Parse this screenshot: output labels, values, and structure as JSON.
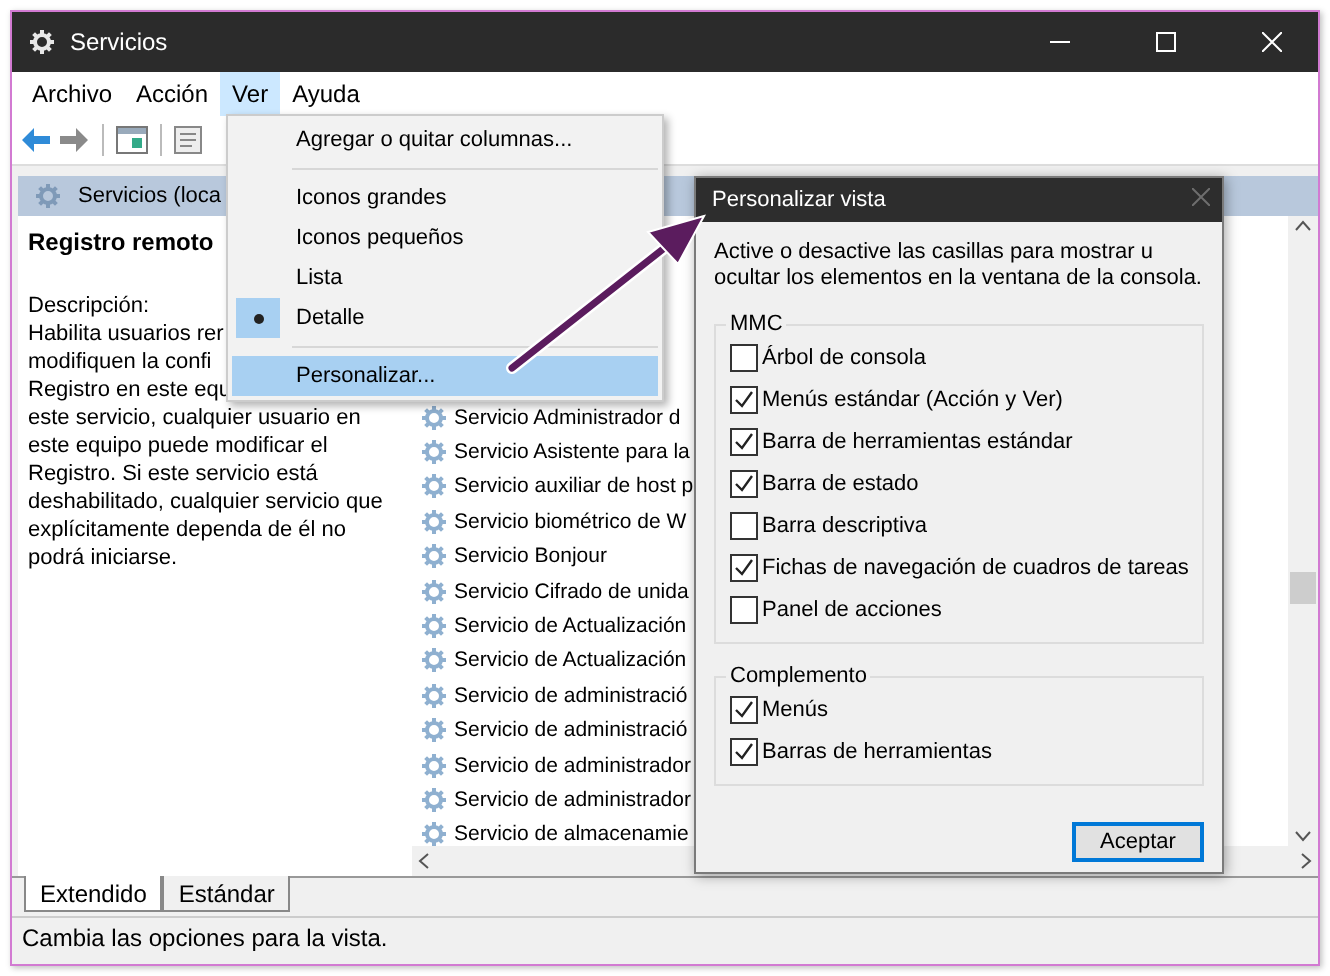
{
  "window": {
    "title": "Servicios"
  },
  "menu_bar": [
    {
      "label": "Archivo",
      "selected": false
    },
    {
      "label": "Acción",
      "selected": false
    },
    {
      "label": "Ver",
      "selected": true
    },
    {
      "label": "Ayuda",
      "selected": false
    }
  ],
  "scope_header": "Servicios (loca",
  "details": {
    "title": "Registro remoto",
    "lines": [
      "Descripción:",
      "Habilita usuarios rer",
      "modifiquen la confi",
      "Registro en este equ",
      "este servicio, cualquier usuario en",
      "este equipo puede modificar el",
      "Registro. Si este servicio está",
      "deshabilitado, cualquier servicio que",
      "explícitamente dependa de él no",
      "podrá iniciarse."
    ]
  },
  "services": [
    "Servicio Administrador d",
    "Servicio Asistente para la",
    "Servicio auxiliar de host p",
    "Servicio biométrico de W",
    "Servicio Bonjour",
    "Servicio Cifrado de unida",
    "Servicio de Actualización",
    "Servicio de Actualización",
    "Servicio de administració",
    "Servicio de administració",
    "Servicio de administrador",
    "Servicio de administrador",
    "Servicio de almacenamie"
  ],
  "bottom_tabs": [
    {
      "label": "Extendido",
      "selected": true
    },
    {
      "label": "Estándar",
      "selected": false
    }
  ],
  "status_bar": "Cambia las opciones para la vista.",
  "view_menu": {
    "items": [
      {
        "kind": "item",
        "label": "Agregar o quitar columnas...",
        "checked": false,
        "selected": false
      },
      {
        "kind": "separator"
      },
      {
        "kind": "item",
        "label": "Iconos grandes",
        "checked": false,
        "selected": false
      },
      {
        "kind": "item",
        "label": "Iconos pequeños",
        "checked": false,
        "selected": false
      },
      {
        "kind": "item",
        "label": "Lista",
        "checked": false,
        "selected": false
      },
      {
        "kind": "item",
        "label": "Detalle",
        "checked": true,
        "selected": false
      },
      {
        "kind": "separator"
      },
      {
        "kind": "item",
        "label": "Personalizar...",
        "checked": false,
        "selected": true
      }
    ]
  },
  "dialog": {
    "title": "Personalizar vista",
    "intro": "Active o desactive las casillas para mostrar u ocultar los elementos en la ventana de la consola.",
    "groups": [
      {
        "label": "MMC",
        "options": [
          {
            "label": "Árbol de consola",
            "checked": false
          },
          {
            "label": "Menús estándar (Acción y Ver)",
            "checked": true
          },
          {
            "label": "Barra de herramientas estándar",
            "checked": true
          },
          {
            "label": "Barra de estado",
            "checked": true
          },
          {
            "label": "Barra descriptiva",
            "checked": false
          },
          {
            "label": "Fichas de navegación de cuadros de tareas",
            "checked": true
          },
          {
            "label": "Panel de acciones",
            "checked": false
          }
        ]
      },
      {
        "label": "Complemento",
        "options": [
          {
            "label": "Menús",
            "checked": true
          },
          {
            "label": "Barras de herramientas",
            "checked": true
          }
        ]
      }
    ],
    "buttons": [
      "Aceptar"
    ]
  }
}
